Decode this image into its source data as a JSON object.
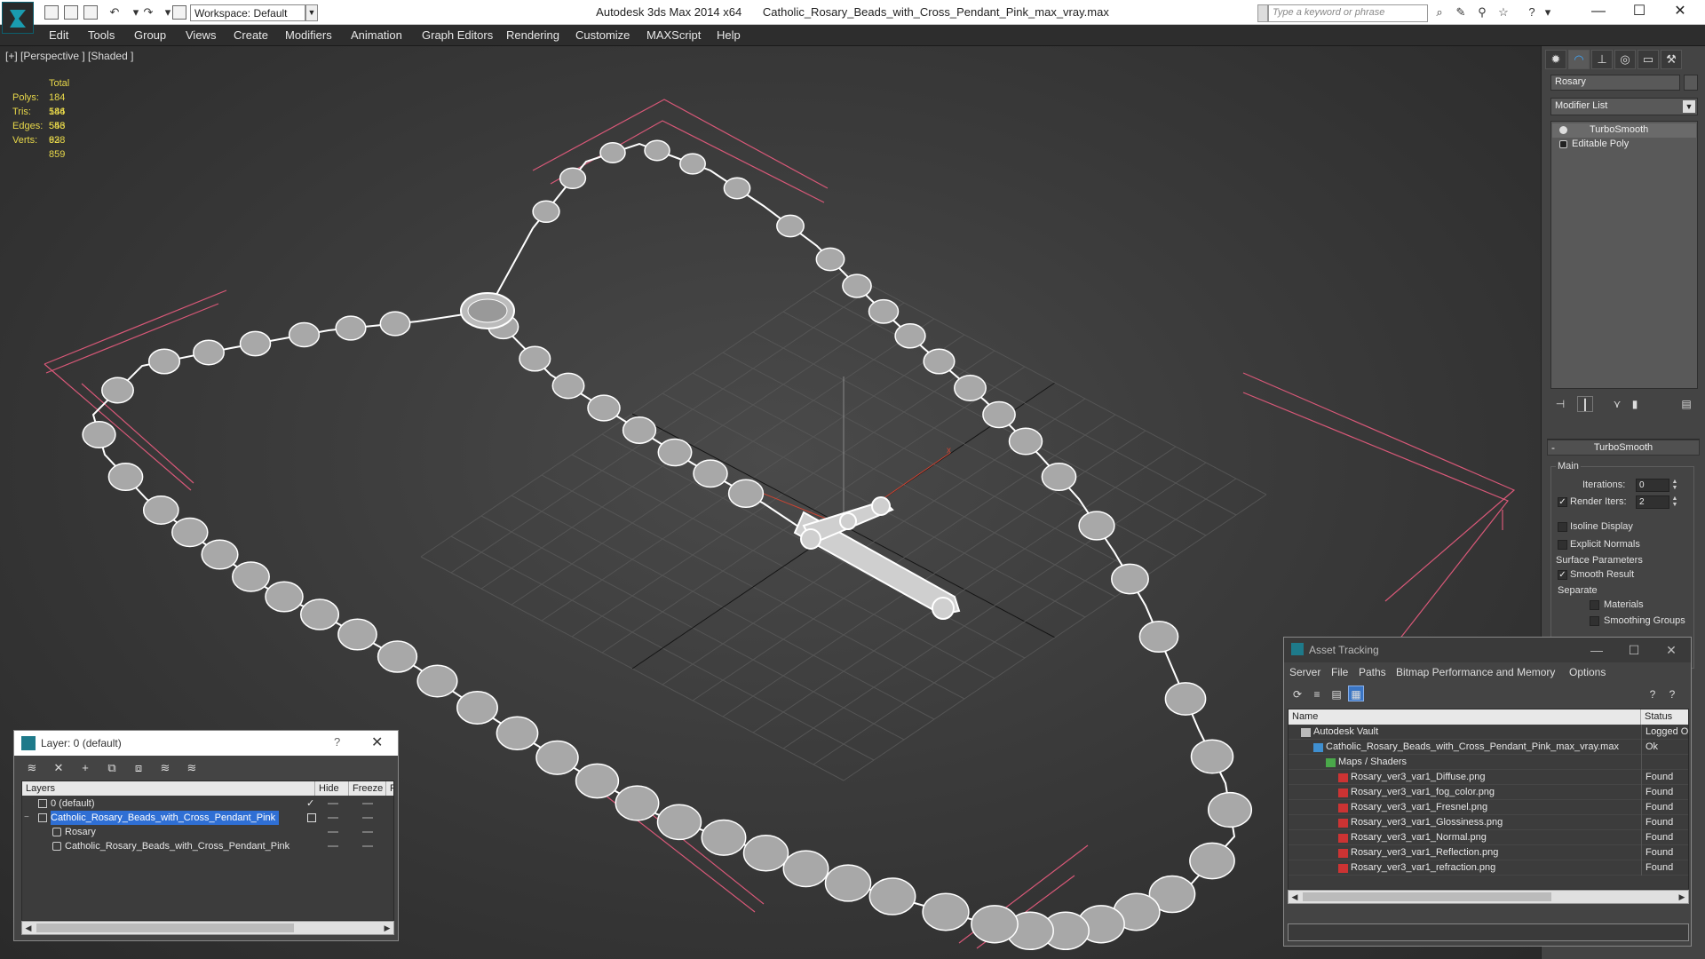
{
  "titlebar": {
    "app": "Autodesk 3ds Max  2014 x64",
    "file": "Catholic_Rosary_Beads_with_Cross_Pendant_Pink_max_vray.max",
    "workspace": "Workspace: Default",
    "search_placeholder": "Type a keyword or phrase"
  },
  "menu": [
    "Edit",
    "Tools",
    "Group",
    "Views",
    "Create",
    "Modifiers",
    "Animation",
    "Graph Editors",
    "Rendering",
    "Customize",
    "MAXScript",
    "Help"
  ],
  "viewport": {
    "label": "[+] [Perspective ] [Shaded ]",
    "stats_header": "Total",
    "stats": [
      {
        "label": "Polys:",
        "value": "184 546"
      },
      {
        "label": "Tris:",
        "value": "184 546"
      },
      {
        "label": "Edges:",
        "value": "553 638"
      },
      {
        "label": "Verts:",
        "value": "92 859"
      }
    ]
  },
  "command_panel": {
    "object_name": "Rosary",
    "modifier_list": "Modifier List",
    "stack": [
      "TurboSmooth",
      "Editable Poly"
    ],
    "turbosmooth": {
      "title": "TurboSmooth",
      "main_label": "Main",
      "iterations_label": "Iterations:",
      "iterations_value": "0",
      "render_iters_label": "Render Iters:",
      "render_iters_value": "2",
      "render_iters_checked": true,
      "isoline_label": "Isoline Display",
      "explicit_normals_label": "Explicit Normals",
      "surface_params_label": "Surface Parameters",
      "smooth_result_label": "Smooth Result",
      "separate_label": "Separate",
      "materials_label": "Materials",
      "smoothing_groups_label": "Smoothing Groups"
    }
  },
  "layer_window": {
    "title": "Layer: 0 (default)",
    "help": "?",
    "columns": [
      "Layers",
      "Hide",
      "Freeze",
      "R"
    ],
    "rows": [
      {
        "name": "0 (default)",
        "selected": false,
        "indent": 0
      },
      {
        "name": "Catholic_Rosary_Beads_with_Cross_Pendant_Pink",
        "selected": true,
        "indent": 0
      },
      {
        "name": "Rosary",
        "selected": false,
        "indent": 1
      },
      {
        "name": "Catholic_Rosary_Beads_with_Cross_Pendant_Pink",
        "selected": false,
        "indent": 1
      }
    ]
  },
  "asset_window": {
    "title": "Asset Tracking",
    "menu": [
      "Server",
      "File",
      "Paths",
      "Bitmap Performance and Memory",
      "Options"
    ],
    "columns": [
      "Name",
      "Status"
    ],
    "rows": [
      {
        "name": "Autodesk Vault",
        "status": "Logged Out",
        "indent": 0,
        "icon": "vault"
      },
      {
        "name": "Catholic_Rosary_Beads_with_Cross_Pendant_Pink_max_vray.max",
        "status": "Ok",
        "indent": 1,
        "icon": "max-file"
      },
      {
        "name": "Maps / Shaders",
        "status": "",
        "indent": 2,
        "icon": "maps"
      },
      {
        "name": "Rosary_ver3_var1_Diffuse.png",
        "status": "Found",
        "indent": 3,
        "icon": "png"
      },
      {
        "name": "Rosary_ver3_var1_fog_color.png",
        "status": "Found",
        "indent": 3,
        "icon": "png"
      },
      {
        "name": "Rosary_ver3_var1_Fresnel.png",
        "status": "Found",
        "indent": 3,
        "icon": "png"
      },
      {
        "name": "Rosary_ver3_var1_Glossiness.png",
        "status": "Found",
        "indent": 3,
        "icon": "png"
      },
      {
        "name": "Rosary_ver3_var1_Normal.png",
        "status": "Found",
        "indent": 3,
        "icon": "png"
      },
      {
        "name": "Rosary_ver3_var1_Reflection.png",
        "status": "Found",
        "indent": 3,
        "icon": "png"
      },
      {
        "name": "Rosary_ver3_var1_refraction.png",
        "status": "Found",
        "indent": 3,
        "icon": "png"
      }
    ]
  },
  "colors": {
    "selection": "#2f6fd4",
    "stats_yellow": "#e8d84a",
    "bounding_box": "#d85878",
    "wire": "#ffffff"
  }
}
